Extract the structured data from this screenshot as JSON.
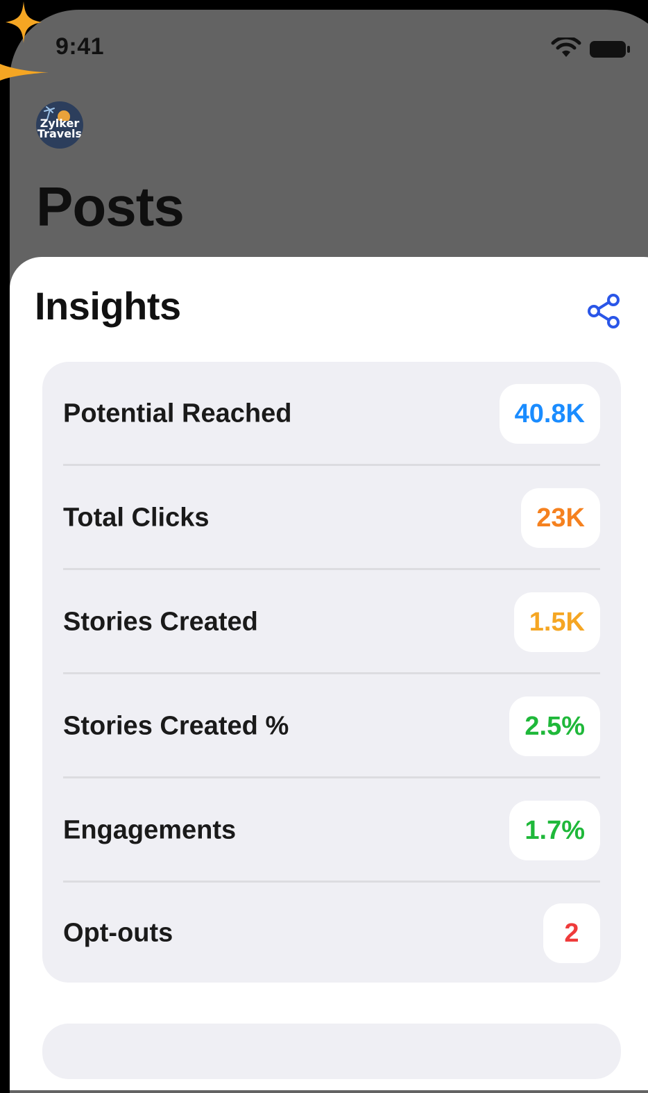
{
  "status_bar": {
    "time": "9:41"
  },
  "header": {
    "logo_text_line1": "Zylker",
    "logo_text_line2": "Travels",
    "title": "Posts"
  },
  "sheet": {
    "title": "Insights",
    "share_icon": "share-icon",
    "rows": [
      {
        "label": "Potential Reached",
        "value": "40.8K",
        "color": "#1a8cff"
      },
      {
        "label": "Total Clicks",
        "value": "23K",
        "color": "#f5811f"
      },
      {
        "label": "Stories Created",
        "value": "1.5K",
        "color": "#f5a623"
      },
      {
        "label": "Stories Created %",
        "value": "2.5%",
        "color": "#1fb83a"
      },
      {
        "label": "Engagements",
        "value": "1.7%",
        "color": "#1fb83a"
      },
      {
        "label": "Opt-outs",
        "value": "2",
        "color": "#ef3b3b"
      }
    ]
  },
  "colors": {
    "accent": "#2a56e8",
    "backdrop": "#636363",
    "sparkle": "#f5a623"
  }
}
